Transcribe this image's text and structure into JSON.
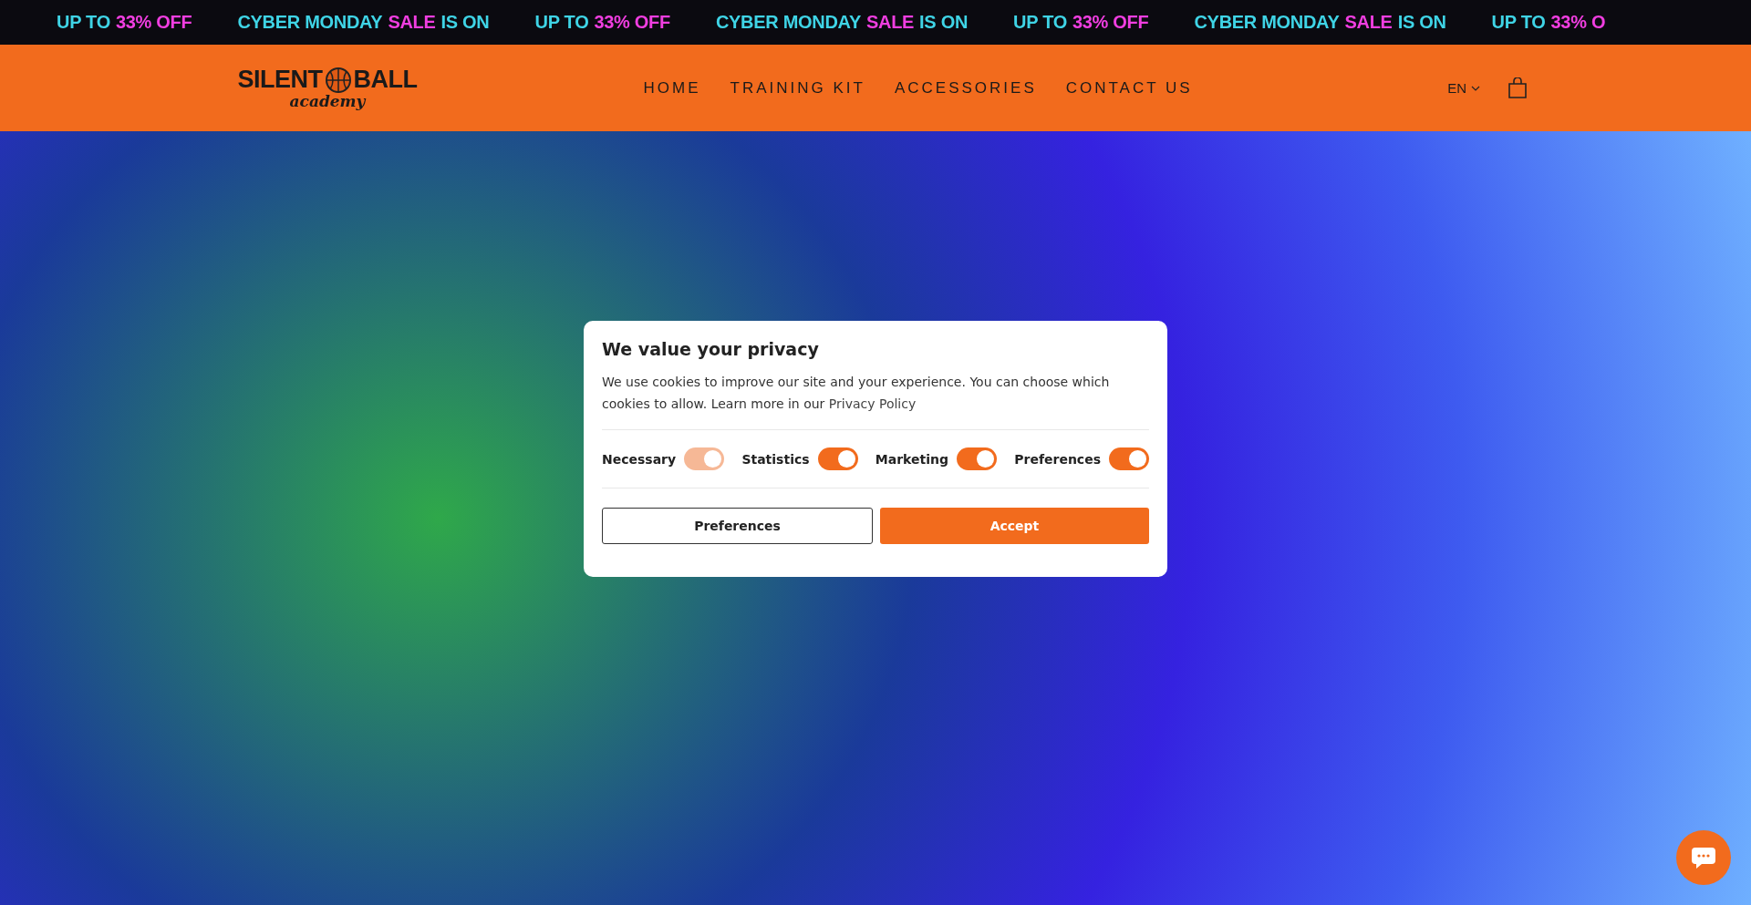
{
  "announcement_bar": {
    "items": [
      {
        "parts": [
          {
            "text": "UP TO",
            "accent": false
          },
          {
            "text": "33% OFF",
            "accent": true
          }
        ]
      },
      {
        "parts": [
          {
            "text": "CYBER MONDAY",
            "accent": false
          },
          {
            "text": "SALE",
            "accent": true
          },
          {
            "text": "IS ON",
            "accent": false
          }
        ]
      },
      {
        "parts": [
          {
            "text": "UP TO",
            "accent": false
          },
          {
            "text": "33% OFF",
            "accent": true
          }
        ]
      },
      {
        "parts": [
          {
            "text": "CYBER MONDAY",
            "accent": false
          },
          {
            "text": "SALE",
            "accent": true
          },
          {
            "text": "IS ON",
            "accent": false
          }
        ]
      },
      {
        "parts": [
          {
            "text": "UP TO",
            "accent": false
          },
          {
            "text": "33% OFF",
            "accent": true
          }
        ]
      },
      {
        "parts": [
          {
            "text": "CYBER MONDAY",
            "accent": false
          },
          {
            "text": "SALE",
            "accent": true
          },
          {
            "text": "IS ON",
            "accent": false
          }
        ]
      },
      {
        "parts": [
          {
            "text": "UP TO",
            "accent": false
          },
          {
            "text": "33% O",
            "accent": true
          }
        ]
      }
    ]
  },
  "header": {
    "logo": {
      "word_1": "SILENT",
      "word_2": "BALL",
      "tagline": "academy"
    },
    "nav": [
      {
        "label": "HOME"
      },
      {
        "label": "TRAINING KIT"
      },
      {
        "label": "ACCESSORIES"
      },
      {
        "label": "CONTACT US"
      }
    ],
    "language": "EN"
  },
  "cookie_dialog": {
    "title": "We value your privacy",
    "text": "We use cookies to improve our site and your experience. You can choose which cookies to allow. Learn more in our",
    "link": "Privacy Policy",
    "toggles": [
      {
        "label": "Necessary",
        "checked": true,
        "disabled": true
      },
      {
        "label": "Statistics",
        "checked": true,
        "disabled": false
      },
      {
        "label": "Marketing",
        "checked": true,
        "disabled": false
      },
      {
        "label": "Preferences",
        "checked": true,
        "disabled": false
      }
    ],
    "buttons": [
      {
        "label": "Preferences",
        "kind": "secondary"
      },
      {
        "label": "Accept",
        "kind": "primary"
      }
    ]
  }
}
